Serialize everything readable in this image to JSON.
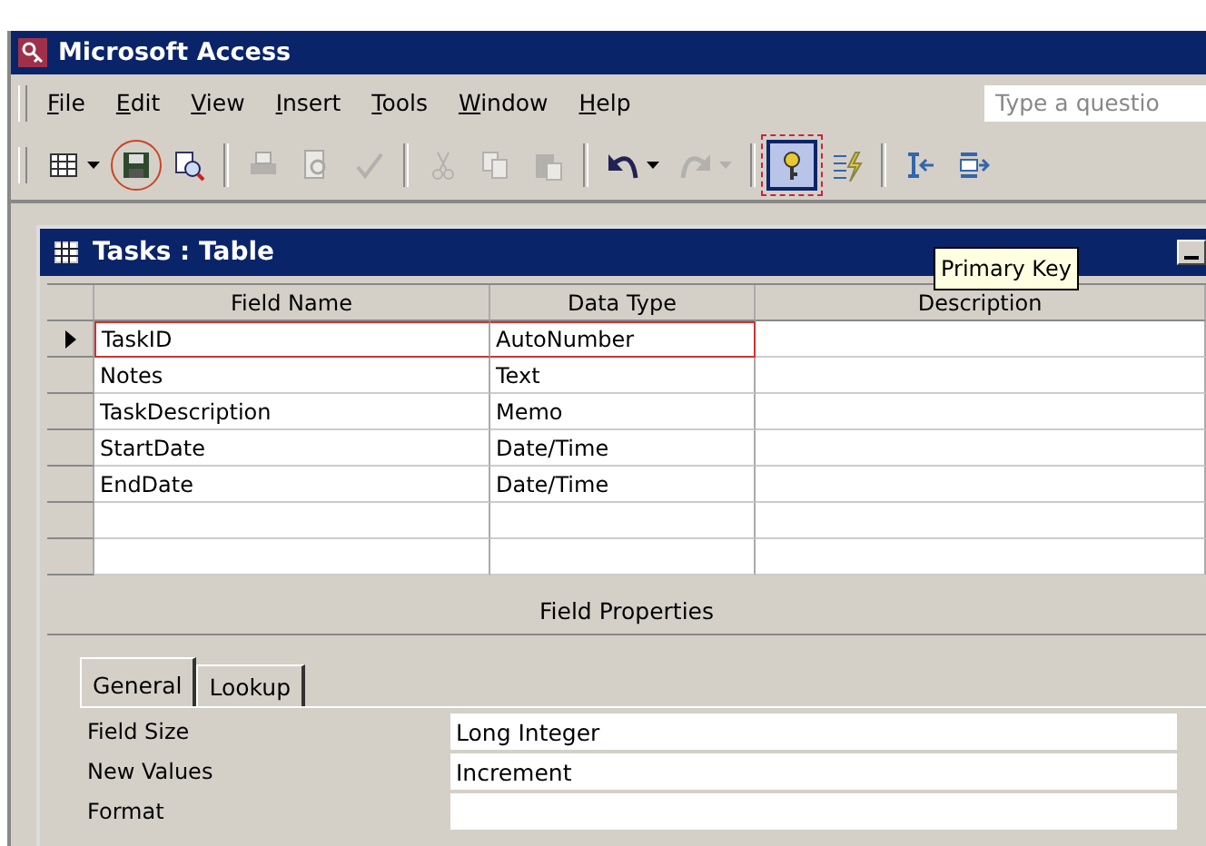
{
  "window": {
    "title": "Microsoft Access"
  },
  "menu": [
    {
      "label": "File"
    },
    {
      "label": "Edit"
    },
    {
      "label": "View"
    },
    {
      "label": "Insert"
    },
    {
      "label": "Tools"
    },
    {
      "label": "Window"
    },
    {
      "label": "Help"
    }
  ],
  "help_box": {
    "placeholder": "Type a questio"
  },
  "toolbar": [
    {
      "kind": "view",
      "disabled": false,
      "pressed": false,
      "circled": false,
      "dropdown": true
    },
    {
      "kind": "save",
      "disabled": false,
      "pressed": false,
      "circled": true,
      "dropdown": false
    },
    {
      "kind": "find",
      "disabled": false,
      "pressed": false,
      "circled": false,
      "dropdown": false
    },
    {
      "kind": "sep"
    },
    {
      "kind": "print",
      "disabled": true,
      "pressed": false,
      "circled": false,
      "dropdown": false
    },
    {
      "kind": "preview",
      "disabled": true,
      "pressed": false,
      "circled": false,
      "dropdown": false
    },
    {
      "kind": "spelling",
      "disabled": true,
      "pressed": false,
      "circled": false,
      "dropdown": false
    },
    {
      "kind": "sep"
    },
    {
      "kind": "cut",
      "disabled": true,
      "pressed": false,
      "circled": false,
      "dropdown": false
    },
    {
      "kind": "copy",
      "disabled": true,
      "pressed": false,
      "circled": false,
      "dropdown": false
    },
    {
      "kind": "paste",
      "disabled": true,
      "pressed": false,
      "circled": false,
      "dropdown": false
    },
    {
      "kind": "sep"
    },
    {
      "kind": "undo",
      "disabled": false,
      "pressed": false,
      "circled": false,
      "dropdown": true
    },
    {
      "kind": "redo",
      "disabled": true,
      "pressed": false,
      "circled": false,
      "dropdown": true
    },
    {
      "kind": "sep"
    },
    {
      "kind": "key",
      "disabled": false,
      "pressed": true,
      "circled": true,
      "dropdown": false
    },
    {
      "kind": "indexes",
      "disabled": false,
      "pressed": false,
      "circled": false,
      "dropdown": false
    },
    {
      "kind": "sep"
    },
    {
      "kind": "insert-rows",
      "disabled": false,
      "pressed": false,
      "circled": false,
      "dropdown": false
    },
    {
      "kind": "delete-rows",
      "disabled": false,
      "pressed": false,
      "circled": false,
      "dropdown": false
    }
  ],
  "tooltip": "Primary Key",
  "table_window": {
    "title": "Tasks : Table",
    "columns": [
      "Field Name",
      "Data Type",
      "Description"
    ],
    "rows": [
      {
        "field_name": "TaskID",
        "data_type": "AutoNumber",
        "selected": true
      },
      {
        "field_name": "Notes",
        "data_type": "Text",
        "selected": false
      },
      {
        "field_name": "TaskDescription",
        "data_type": "Memo",
        "selected": false
      },
      {
        "field_name": "StartDate",
        "data_type": "Date/Time",
        "selected": false
      },
      {
        "field_name": "EndDate",
        "data_type": "Date/Time",
        "selected": false
      }
    ],
    "field_properties": {
      "title": "Field Properties",
      "tabs": [
        {
          "label": "General",
          "selected": true
        },
        {
          "label": "Lookup",
          "selected": false
        }
      ],
      "properties": [
        {
          "label": "Field Size",
          "value": "Long Integer"
        },
        {
          "label": "New Values",
          "value": "Increment"
        },
        {
          "label": "Format"
        }
      ]
    }
  }
}
